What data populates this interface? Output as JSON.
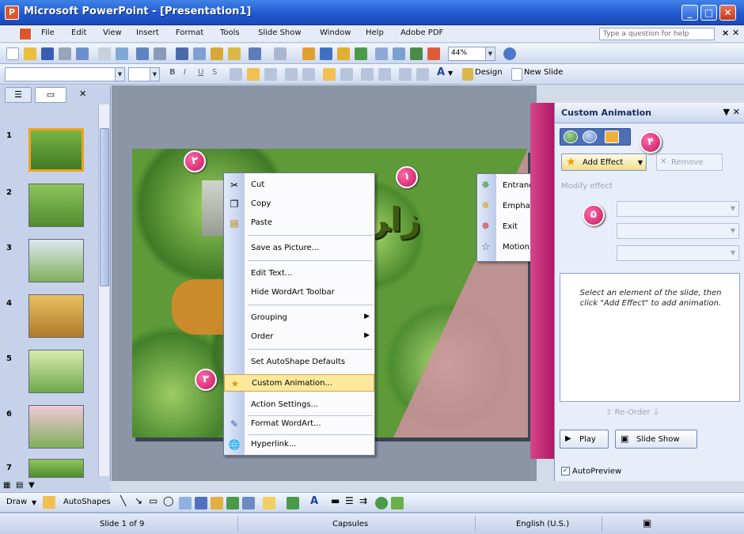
{
  "window": {
    "title": "Microsoft PowerPoint - [Presentation1]"
  },
  "menubar": {
    "items": [
      "File",
      "Edit",
      "View",
      "Insert",
      "Format",
      "Tools",
      "Slide Show",
      "Window",
      "Help",
      "Adobe PDF"
    ],
    "ask_placeholder": "Type a question for help"
  },
  "toolbar": {
    "zoom": "44%",
    "design_label": "Design",
    "new_slide_label": "New Slide"
  },
  "thumbnails": {
    "numbers": [
      "1",
      "2",
      "3",
      "4",
      "5",
      "6",
      "7"
    ]
  },
  "badges": [
    "۱",
    "۲",
    "۳",
    "۴",
    "۵"
  ],
  "context_menu": {
    "items": [
      {
        "label": "Cut",
        "icon": "scissors-icon"
      },
      {
        "label": "Copy",
        "icon": "copy-icon"
      },
      {
        "label": "Paste",
        "icon": "paste-icon"
      },
      {
        "label": "Save as Picture...",
        "icon": ""
      },
      {
        "label": "Edit Text...",
        "icon": ""
      },
      {
        "label": "Hide WordArt Toolbar",
        "icon": ""
      },
      {
        "label": "Grouping",
        "icon": "",
        "submenu": true
      },
      {
        "label": "Order",
        "icon": "",
        "submenu": true
      },
      {
        "label": "Set AutoShape Defaults",
        "icon": ""
      },
      {
        "label": "Custom Animation...",
        "icon": "custom-animation-icon",
        "highlighted": true
      },
      {
        "label": "Action Settings...",
        "icon": ""
      },
      {
        "label": "Format WordArt...",
        "icon": "format-wordart-icon"
      },
      {
        "label": "Hyperlink...",
        "icon": "hyperlink-icon"
      }
    ]
  },
  "effect_submenu": {
    "items": [
      {
        "label": "Entrance",
        "icon": "entrance-star-icon",
        "color": "#2e8b2e"
      },
      {
        "label": "Emphasis",
        "icon": "emphasis-star-icon",
        "color": "#d4a000"
      },
      {
        "label": "Exit",
        "icon": "exit-star-icon",
        "color": "#c0282a"
      },
      {
        "label": "Motion Paths",
        "icon": "motion-paths-star-icon",
        "color": "#555555"
      }
    ]
  },
  "task_pane": {
    "title": "Custom Animation",
    "add_effect": "Add Effect",
    "remove": "Remove",
    "modify_label": "Modify effect",
    "message": "Select an element of the slide, then click \"Add Effect\" to add animation.",
    "reorder": "Re-Order",
    "play": "Play",
    "slide_show": "Slide Show",
    "autopreview": "AutoPreview"
  },
  "drawbar": {
    "draw": "Draw",
    "autoshapes": "AutoShapes"
  },
  "statusbar": {
    "slide": "Slide 1 of 9",
    "design": "Capsules",
    "language": "English (U.S.)"
  },
  "colors": {
    "title_bar": "#2259d0",
    "badge": "#d81b72",
    "highlight": "#fde89c",
    "task_pane_accent": "#b01866"
  }
}
